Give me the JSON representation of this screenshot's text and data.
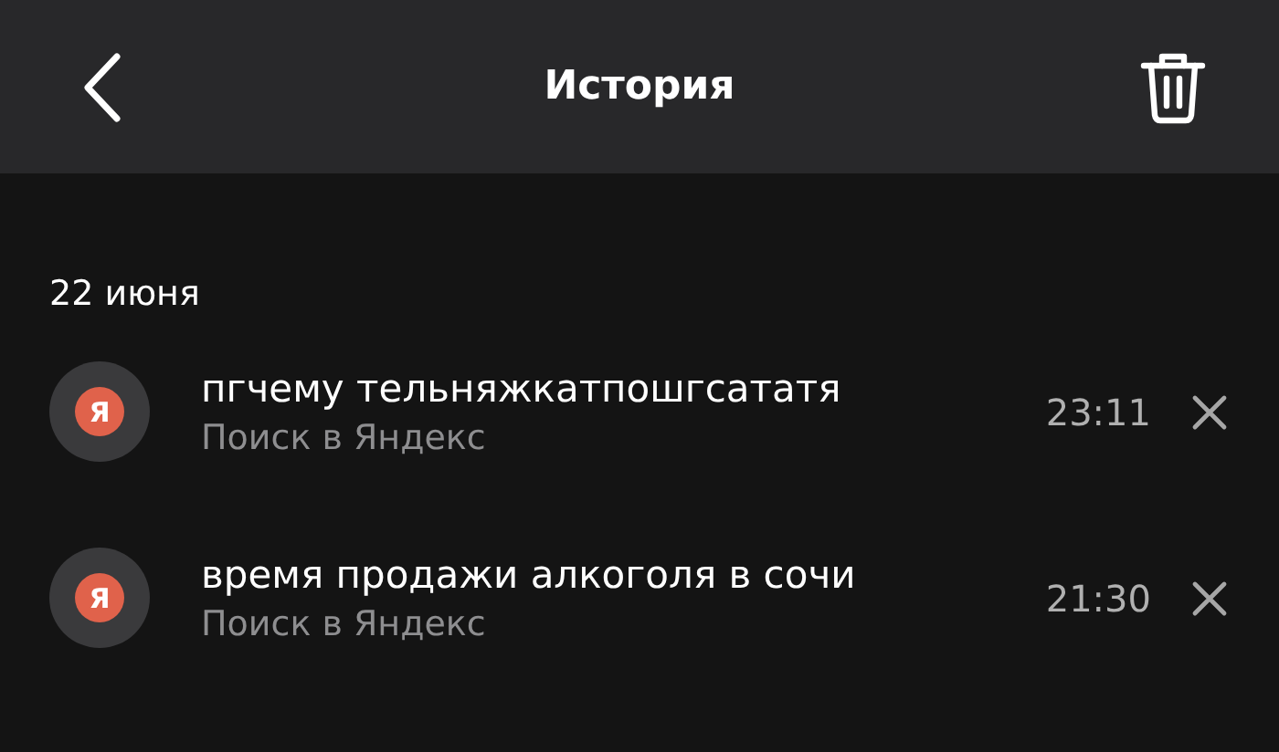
{
  "header": {
    "title": "История"
  },
  "sections": [
    {
      "date": "22 июня",
      "items": [
        {
          "logo": "Я",
          "query": "пгчему тельняжкатпошгсататя",
          "source": "Поиск в Яндекс",
          "time": "23:11"
        },
        {
          "logo": "Я",
          "query": "время продажи алкоголя в сочи",
          "source": "Поиск в Яндекс",
          "time": "21:30"
        }
      ]
    }
  ]
}
